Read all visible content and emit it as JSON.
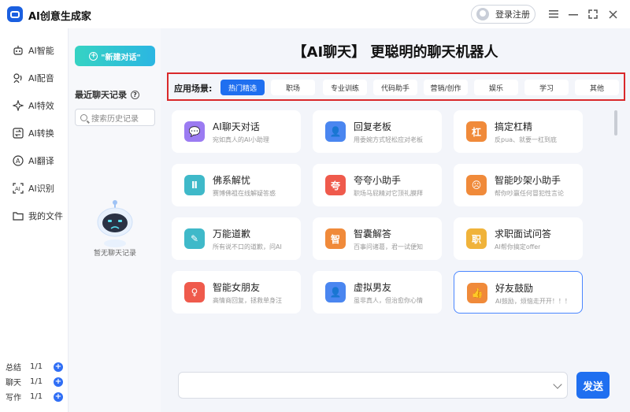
{
  "app": {
    "title": "AI创意生成家",
    "login_label": "登录注册"
  },
  "window_controls": [
    "menu-icon",
    "minimize-icon",
    "maximize-icon",
    "close-icon"
  ],
  "rail": {
    "items": [
      {
        "label": "AI智能",
        "icon": "robot-icon"
      },
      {
        "label": "AI配音",
        "icon": "voice-icon"
      },
      {
        "label": "AI特效",
        "icon": "sparkle-icon"
      },
      {
        "label": "AI转换",
        "icon": "convert-icon"
      },
      {
        "label": "AI翻译",
        "icon": "translate-icon"
      },
      {
        "label": "AI识别",
        "icon": "scan-icon"
      },
      {
        "label": "我的文件",
        "icon": "folder-icon"
      }
    ],
    "stats": [
      {
        "label": "总结",
        "count": "1/1"
      },
      {
        "label": "聊天",
        "count": "1/1"
      },
      {
        "label": "写作",
        "count": "1/1"
      }
    ]
  },
  "side": {
    "new_chat": "\"新建对话\"",
    "recent_title": "最近聊天记录",
    "search_placeholder": "搜索历史记录",
    "empty": "暂无聊天记录"
  },
  "main": {
    "title": "【AI聊天】 更聪明的聊天机器人",
    "scene_label": "应用场景:",
    "scenes": [
      "热门精选",
      "职场",
      "专业训练",
      "代码助手",
      "营销/创作",
      "娱乐",
      "学习",
      "其他"
    ],
    "active_scene": "热门精选",
    "cards": [
      {
        "title": "AI聊天对话",
        "desc": "宛如真人的AI小助理",
        "color": "#9b7bf2",
        "icon": "chat-icon",
        "glyph": "💬"
      },
      {
        "title": "回复老板",
        "desc": "用委婉方式轻松应对老板",
        "color": "#4a86f0",
        "icon": "boss-icon",
        "glyph": "👤"
      },
      {
        "title": "搞定杠精",
        "desc": "反pua、就要一杠到底",
        "color": "#f08a3a",
        "icon": "bar-icon",
        "glyph": "杠"
      },
      {
        "title": "佛系解忧",
        "desc": "赛博佛祖在线解疑答惑",
        "color": "#3fb9c9",
        "icon": "buddha-icon",
        "glyph": "Ⅱ"
      },
      {
        "title": "夸夸小助手",
        "desc": "职场马屁精对它顶礼膜拜",
        "color": "#ef5a4c",
        "icon": "praise-icon",
        "glyph": "夸"
      },
      {
        "title": "智能吵架小助手",
        "desc": "帮你吵赢任何冒犯性言论",
        "color": "#f08a3a",
        "icon": "angry-icon",
        "glyph": "☹"
      },
      {
        "title": "万能道歉",
        "desc": "所有说不口的道歉，问AI",
        "color": "#3fb9c9",
        "icon": "apology-icon",
        "glyph": "✎"
      },
      {
        "title": "智囊解答",
        "desc": "百事问诸葛，君一试便知",
        "color": "#f08a3a",
        "icon": "sage-icon",
        "glyph": "智"
      },
      {
        "title": "求职面试问答",
        "desc": "AI帮你搞定offer",
        "color": "#f0b33a",
        "icon": "job-icon",
        "glyph": "职"
      },
      {
        "title": "智能女朋友",
        "desc": "高情商回复，拯救单身汪",
        "color": "#ef5a4c",
        "icon": "girlfriend-icon",
        "glyph": "♀"
      },
      {
        "title": "虚拟男友",
        "desc": "虽非真人，但治愈你心情",
        "color": "#4a86f0",
        "icon": "boyfriend-icon",
        "glyph": "👤"
      },
      {
        "title": "好友鼓励",
        "desc": "AI鼓励，烦恼走开开！！！",
        "color": "#f08a3a",
        "icon": "thumbs-up-icon",
        "glyph": "👍"
      }
    ],
    "send_label": "发送"
  }
}
